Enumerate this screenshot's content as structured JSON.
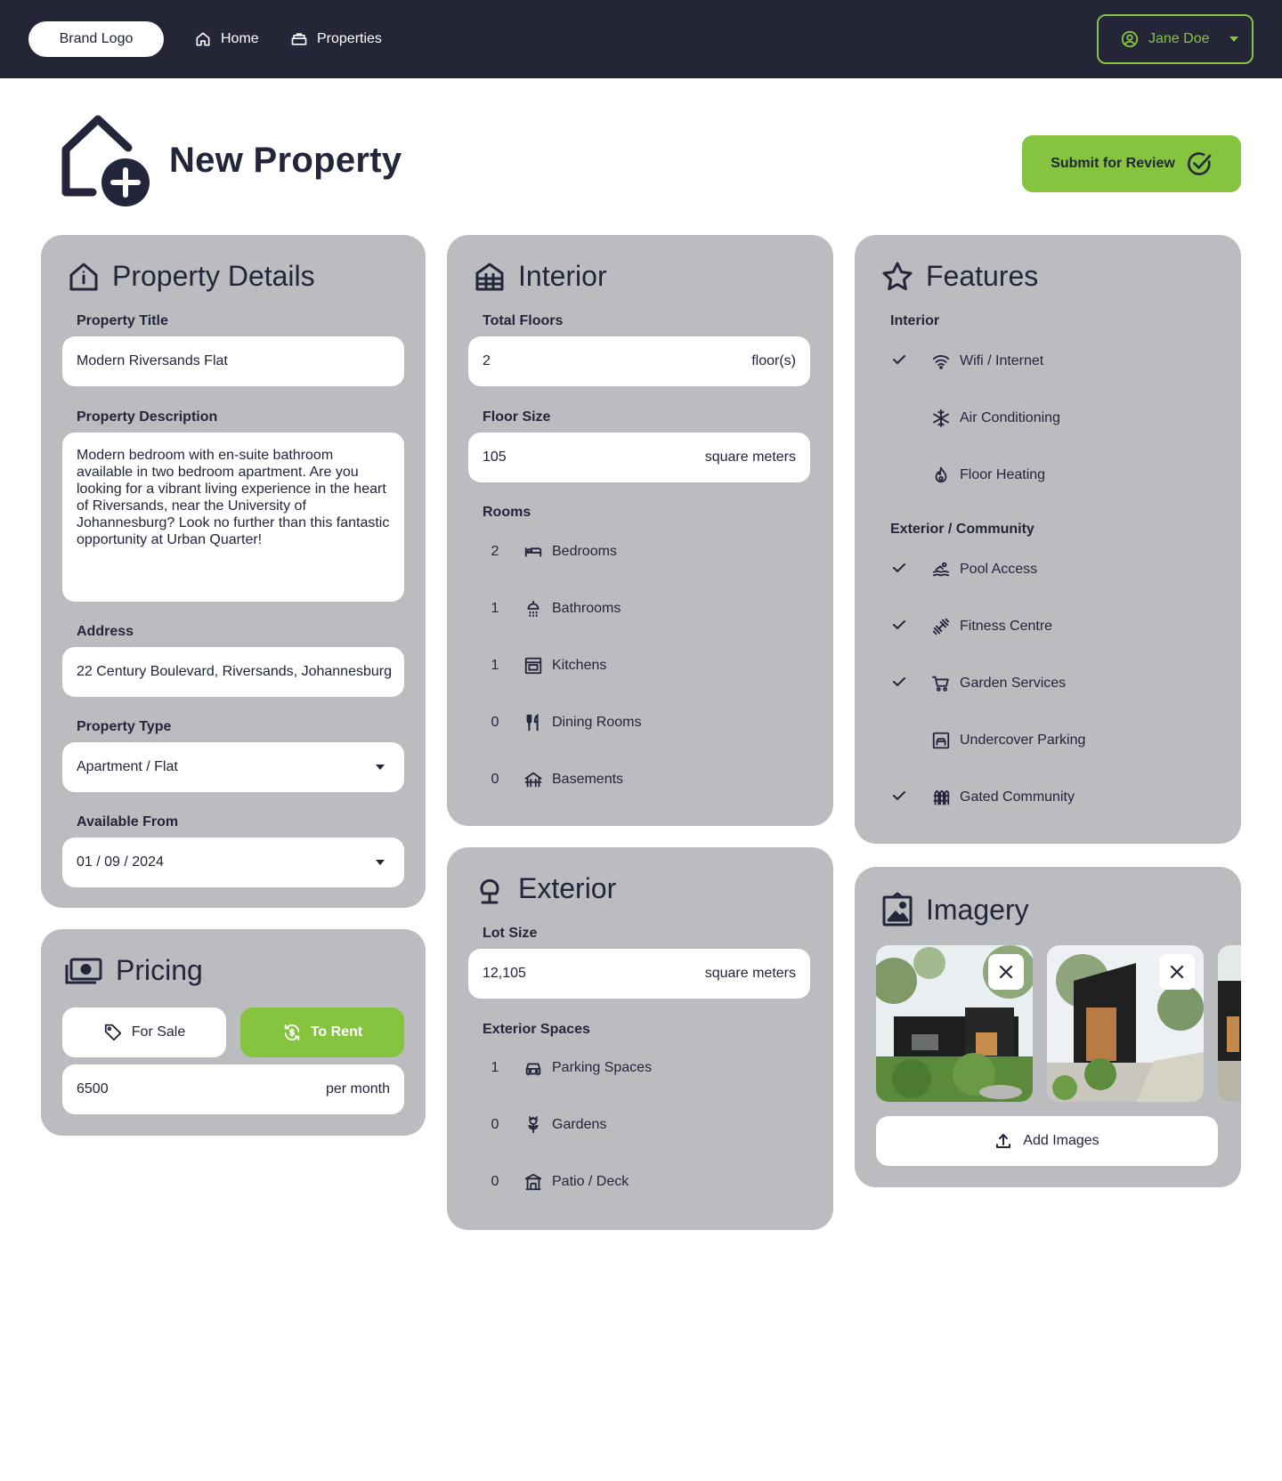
{
  "nav": {
    "brand": "Brand Logo",
    "links": [
      {
        "label": "Home",
        "icon": "home-icon"
      },
      {
        "label": "Properties",
        "icon": "properties-icon"
      }
    ],
    "user": "Jane Doe"
  },
  "page": {
    "title": "New Property",
    "submit_label": "Submit for Review"
  },
  "details": {
    "title": "Property Details",
    "title_label": "Property Title",
    "title_value": "Modern Riversands Flat",
    "desc_label": "Property Description",
    "desc_value": "Modern bedroom with en-suite bathroom available in two bedroom apartment. Are you looking for a vibrant living experience in the heart of Riversands, near the University of Johannesburg? Look no further than this fantastic opportunity at Urban Quarter!",
    "address_label": "Address",
    "address_value": "22 Century Boulevard, Riversands, Johannesburg",
    "type_label": "Property Type",
    "type_value": "Apartment / Flat",
    "available_label": "Available From",
    "available_value": "01 / 09 / 2024"
  },
  "pricing": {
    "title": "Pricing",
    "for_sale": "For Sale",
    "to_rent": "To Rent",
    "selected": "To Rent",
    "price_value": "6500",
    "price_unit": "per month"
  },
  "interior": {
    "title": "Interior",
    "floors_label": "Total Floors",
    "floors_value": "2",
    "floors_unit": "floor(s)",
    "size_label": "Floor Size",
    "size_value": "105",
    "size_unit": "square meters",
    "rooms_label": "Rooms",
    "rooms": [
      {
        "count": "2",
        "label": "Bedrooms",
        "icon": "bed-icon"
      },
      {
        "count": "1",
        "label": "Bathrooms",
        "icon": "shower-icon"
      },
      {
        "count": "1",
        "label": "Kitchens",
        "icon": "oven-icon"
      },
      {
        "count": "0",
        "label": "Dining Rooms",
        "icon": "utensils-icon"
      },
      {
        "count": "0",
        "label": "Basements",
        "icon": "basement-icon"
      }
    ]
  },
  "exterior": {
    "title": "Exterior",
    "lot_label": "Lot Size",
    "lot_value": "12,105",
    "lot_unit": "square meters",
    "spaces_label": "Exterior Spaces",
    "spaces": [
      {
        "count": "1",
        "label": "Parking Spaces",
        "icon": "car-icon"
      },
      {
        "count": "0",
        "label": "Gardens",
        "icon": "flower-icon"
      },
      {
        "count": "0",
        "label": "Patio / Deck",
        "icon": "patio-icon"
      }
    ]
  },
  "features": {
    "title": "Features",
    "interior_label": "Interior",
    "interior": [
      {
        "label": "Wifi / Internet",
        "icon": "wifi-icon",
        "checked": true
      },
      {
        "label": "Air Conditioning",
        "icon": "snowflake-icon",
        "checked": false
      },
      {
        "label": "Floor Heating",
        "icon": "flame-icon",
        "checked": false
      }
    ],
    "exterior_label": "Exterior / Community",
    "exterior": [
      {
        "label": "Pool Access",
        "icon": "swimming-icon",
        "checked": true
      },
      {
        "label": "Fitness Centre",
        "icon": "dumbbell-icon",
        "checked": true
      },
      {
        "label": "Garden Services",
        "icon": "cart-icon",
        "checked": true
      },
      {
        "label": "Undercover Parking",
        "icon": "garage-icon",
        "checked": false
      },
      {
        "label": "Gated Community",
        "icon": "fence-icon",
        "checked": true
      }
    ]
  },
  "imagery": {
    "title": "Imagery",
    "add_label": "Add Images"
  },
  "colors": {
    "nav_bg": "#242638",
    "accent": "#86c440",
    "card_bg": "#bbbcc0",
    "text": "#23263a"
  }
}
